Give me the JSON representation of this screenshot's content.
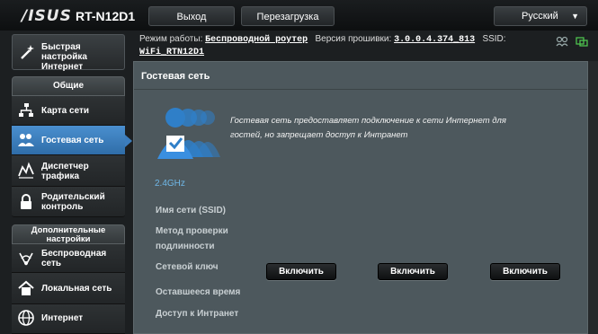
{
  "header": {
    "logo": "/ISUS",
    "model": "RT-N12D1",
    "logout_label": "Выход",
    "reboot_label": "Перезагрузка",
    "language": "Русский"
  },
  "status": {
    "mode_label": "Режим работы:",
    "mode_value": "Беспроводной роутер",
    "firmware_label": "Версия прошивки:",
    "firmware_value": "3.0.0.4.374_813",
    "ssid_label": "SSID:",
    "ssid_value": "WiFi_RTN12D1"
  },
  "sidebar": {
    "quick_setup": "Быстрая настройка Интернет",
    "general_header": "Общие",
    "general_items": [
      {
        "label": "Карта сети",
        "icon": "network-map-icon"
      },
      {
        "label": "Гостевая сеть",
        "icon": "guest-network-icon"
      },
      {
        "label": "Диспетчер трафика",
        "icon": "traffic-manager-icon"
      },
      {
        "label": "Родительский контроль",
        "icon": "lock-icon"
      }
    ],
    "advanced_header": "Дополнительные настройки",
    "advanced_items": [
      {
        "label": "Беспроводная сеть",
        "icon": "wireless-icon"
      },
      {
        "label": "Локальная сеть",
        "icon": "home-icon"
      },
      {
        "label": "Интернет",
        "icon": "globe-icon"
      }
    ]
  },
  "main": {
    "title": "Гостевая сеть",
    "description": "Гостевая сеть предоставляет подключение к сети Интернет для гостей, но запрещает доступ к Интранет",
    "band": "2.4GHz",
    "fields": [
      "Имя сети (SSID)",
      "Метод проверки подлинности",
      "Сетевой ключ",
      "Оставшееся время",
      "Доступ к Интранет"
    ],
    "enable_buttons": [
      "Включить",
      "Включить",
      "Включить"
    ]
  },
  "colors": {
    "accent": "#3c7dbd",
    "panel": "#4d585d",
    "band_text": "#6fb7e6"
  }
}
